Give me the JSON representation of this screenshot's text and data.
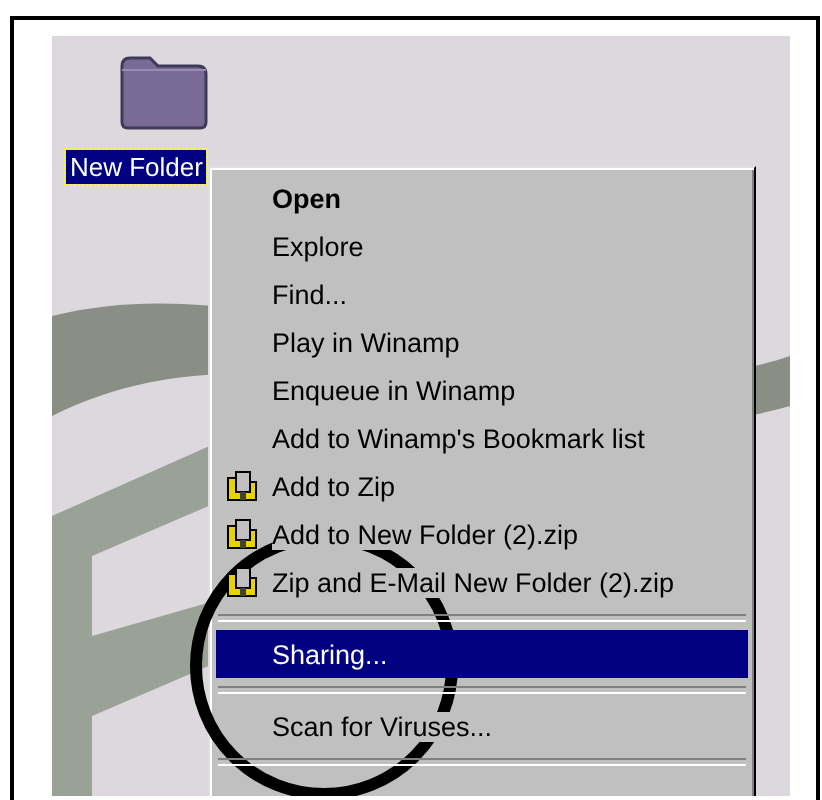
{
  "desktop": {
    "icon": {
      "label": "New Folder",
      "selected": true
    }
  },
  "context_menu": {
    "items": [
      {
        "kind": "item",
        "label": "Open",
        "default": true,
        "selected": false
      },
      {
        "kind": "item",
        "label": "Explore",
        "default": false,
        "selected": false
      },
      {
        "kind": "item",
        "label": "Find...",
        "default": false,
        "selected": false
      },
      {
        "kind": "item",
        "label": "Play in Winamp",
        "default": false,
        "selected": false
      },
      {
        "kind": "item",
        "label": "Enqueue in Winamp",
        "default": false,
        "selected": false
      },
      {
        "kind": "item",
        "label": "Add to Winamp's Bookmark list",
        "default": false,
        "selected": false
      },
      {
        "kind": "zip",
        "label": "Add to Zip",
        "default": false,
        "selected": false
      },
      {
        "kind": "zip",
        "label": "Add to New Folder (2).zip",
        "default": false,
        "selected": false
      },
      {
        "kind": "zip",
        "label": "Zip and E-Mail New Folder (2).zip",
        "default": false,
        "selected": false
      },
      {
        "kind": "separator"
      },
      {
        "kind": "item",
        "label": "Sharing...",
        "default": false,
        "selected": true
      },
      {
        "kind": "separator"
      },
      {
        "kind": "item",
        "label": "Scan for Viruses...",
        "default": false,
        "selected": false
      },
      {
        "kind": "separator"
      }
    ]
  }
}
